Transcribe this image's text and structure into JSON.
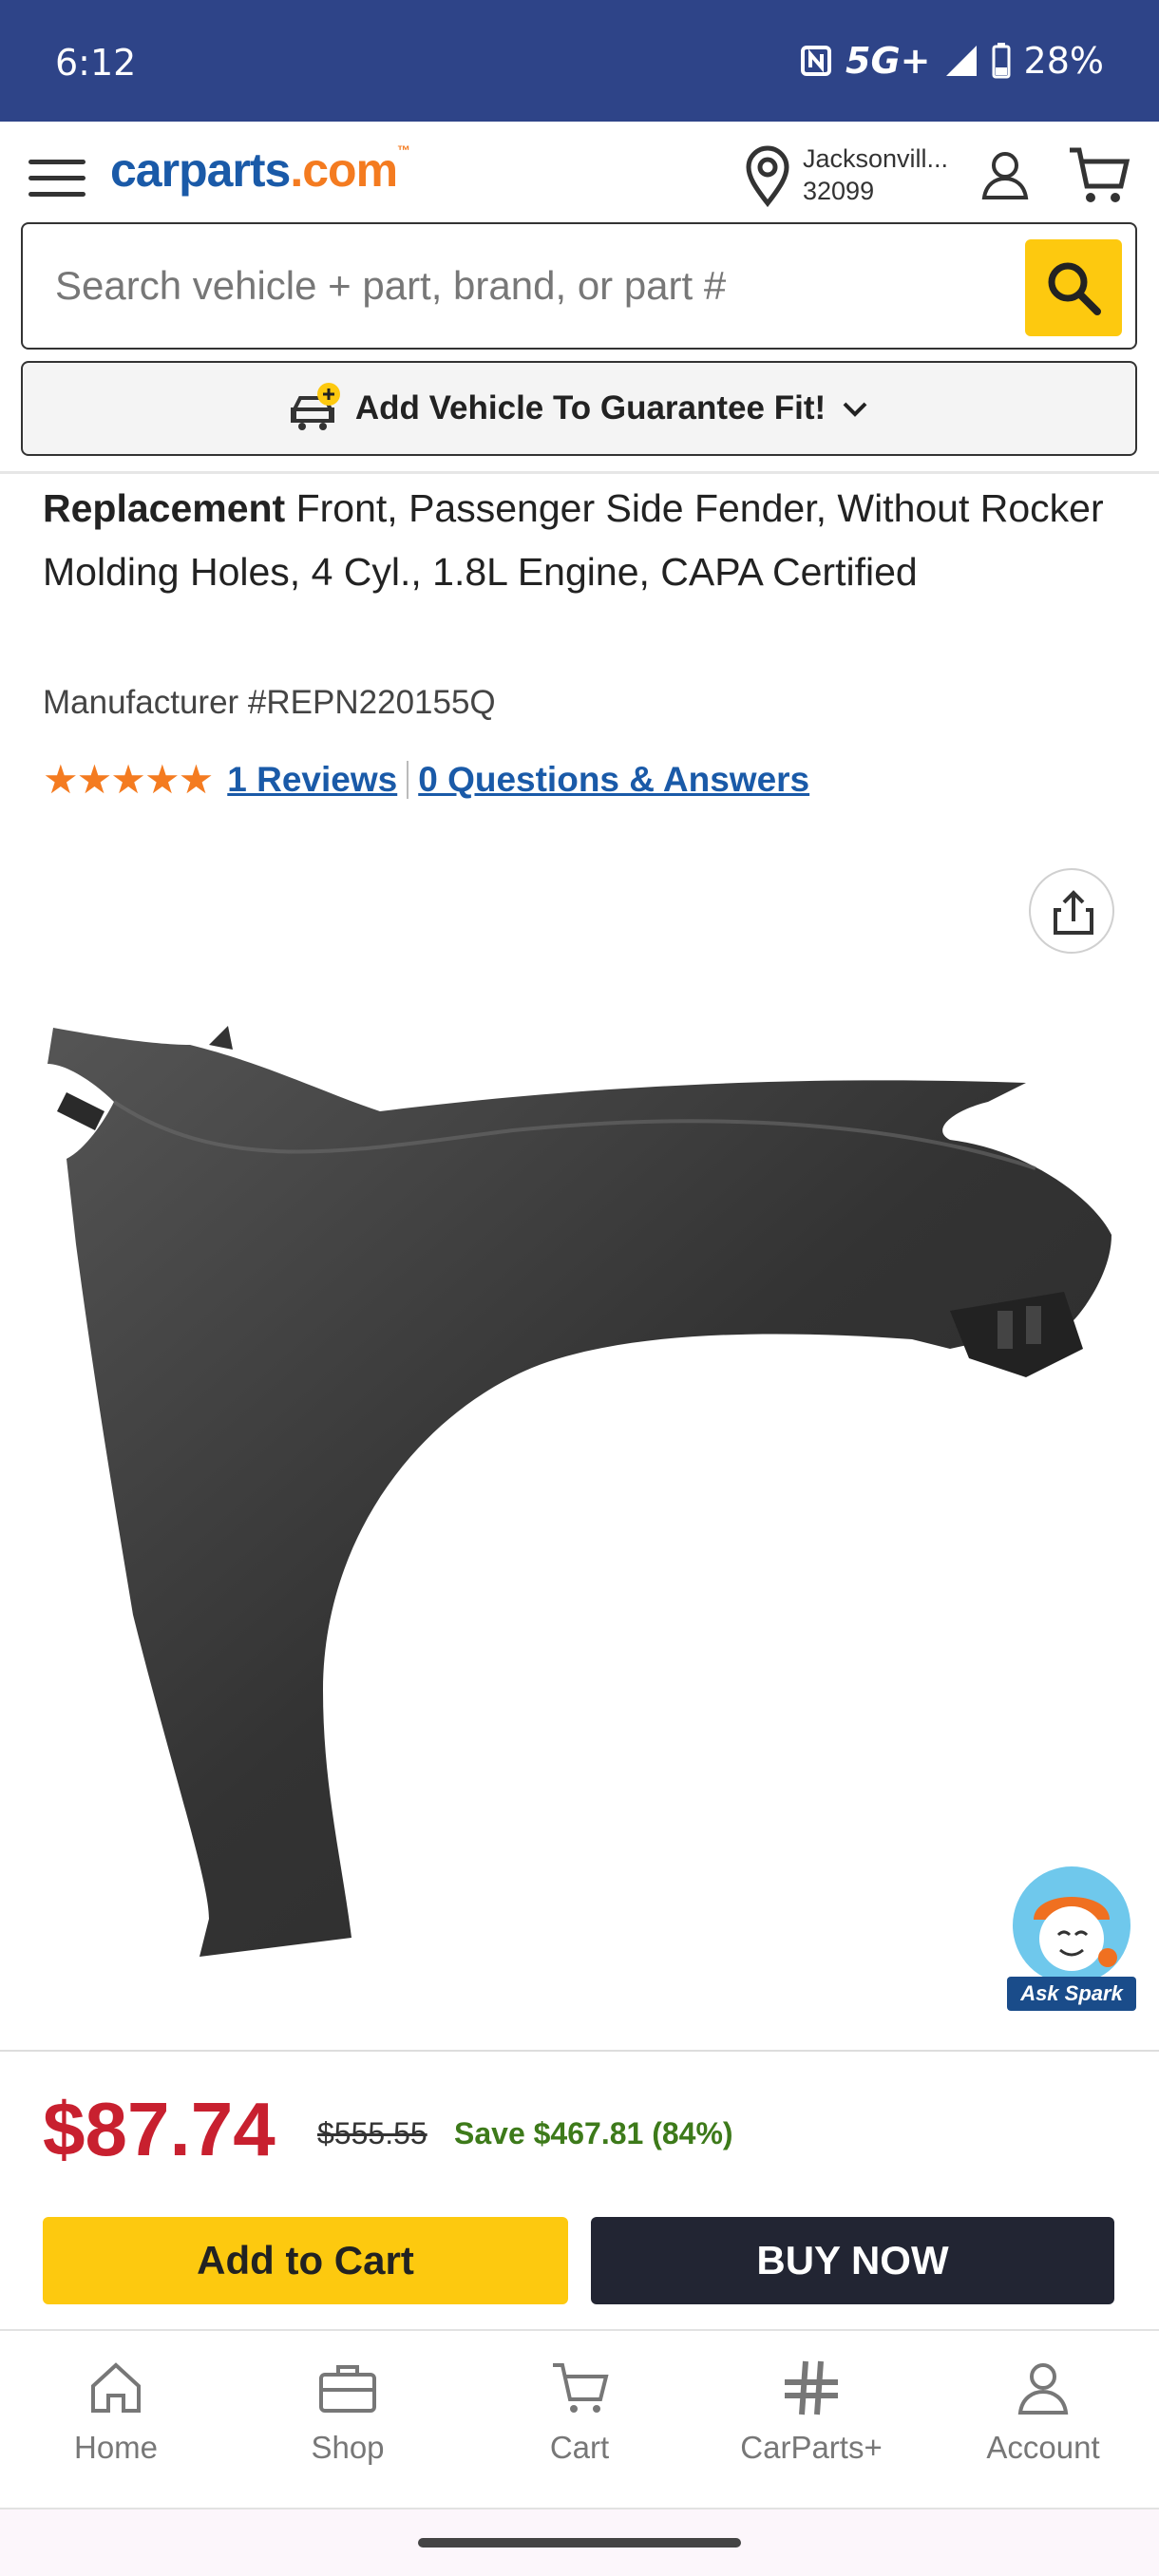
{
  "status_bar": {
    "time": "6:12",
    "network": "5G+",
    "battery": "28%"
  },
  "header": {
    "logo_main": "carparts",
    "logo_suffix": ".com",
    "logo_tm": "™",
    "location_city": "Jacksonvill...",
    "location_zip": "32099"
  },
  "search": {
    "placeholder": "Search vehicle + part, brand, or part #"
  },
  "vehicle_bar": {
    "label": "Add Vehicle To Guarantee Fit!"
  },
  "product": {
    "brand": "Replacement",
    "title": " Front, Passenger Side Fender, Without Rocker Molding Holes, 4 Cyl., 1.8L Engine, CAPA Certified",
    "manufacturer": "Manufacturer #REPN220155Q",
    "stars": "★★★★★",
    "reviews": "1 Reviews",
    "questions": "0 Questions & Answers"
  },
  "spark": {
    "label": "Ask Spark"
  },
  "pricing": {
    "price": "$87.74",
    "old_price": "$555.55",
    "save": "Save $467.81 (84%)"
  },
  "actions": {
    "add_to_cart": "Add to Cart",
    "buy_now": "BUY NOW"
  },
  "nav": [
    {
      "label": "Home",
      "icon": "home-icon"
    },
    {
      "label": "Shop",
      "icon": "toolbox-icon"
    },
    {
      "label": "Cart",
      "icon": "cart-icon"
    },
    {
      "label": "CarParts+",
      "icon": "carparts-plus-icon"
    },
    {
      "label": "Account",
      "icon": "account-icon"
    }
  ],
  "colors": {
    "brand_blue": "#1a5aa8",
    "brand_orange": "#f47b20",
    "cta_yellow": "#fdc90f",
    "price_red": "#c8202f",
    "save_green": "#3d7a1a",
    "status_bar": "#2e4488"
  }
}
